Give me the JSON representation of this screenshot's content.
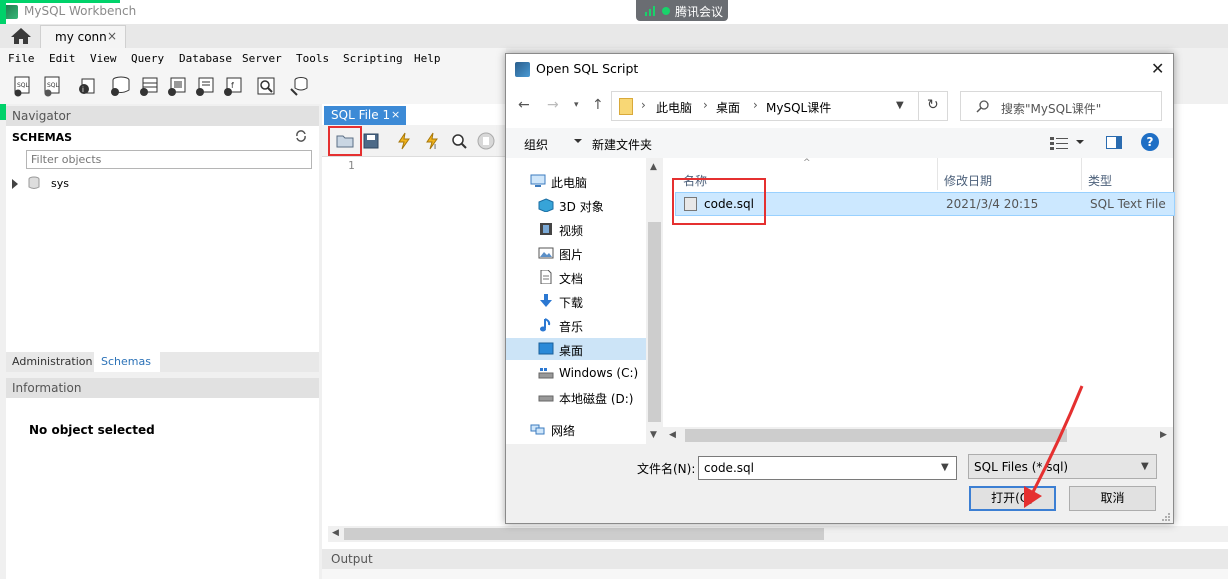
{
  "app": {
    "title": "MySQL Workbench"
  },
  "meeting": {
    "label": "腾讯会议"
  },
  "connection_tab": {
    "label": "my conn",
    "close": "×"
  },
  "menu": [
    "File",
    "Edit",
    "View",
    "Query",
    "Database",
    "Server",
    "Tools",
    "Scripting",
    "Help"
  ],
  "navigator": {
    "header": "Navigator",
    "schemas_title": "SCHEMAS",
    "filter_placeholder": "Filter objects",
    "schemas": [
      "sys"
    ]
  },
  "bottom_tabs": {
    "administration": "Administration",
    "schemas": "Schemas"
  },
  "information": {
    "header": "Information",
    "message": "No object selected"
  },
  "editor": {
    "tab_label": "SQL File 1",
    "tab_close": "×",
    "line_number": "1"
  },
  "output": {
    "header": "Output"
  },
  "dialog": {
    "title": "Open SQL Script",
    "close": "✕",
    "breadcrumb": [
      "此电脑",
      "桌面",
      "MySQL课件"
    ],
    "search_placeholder": "搜索\"MySQL课件\"",
    "organize": "组织",
    "new_folder": "新建文件夹",
    "tree": [
      {
        "label": "此电脑",
        "icon": "computer-icon"
      },
      {
        "label": "3D 对象",
        "icon": "3d-objects-icon"
      },
      {
        "label": "视频",
        "icon": "video-icon"
      },
      {
        "label": "图片",
        "icon": "pictures-icon"
      },
      {
        "label": "文档",
        "icon": "documents-icon"
      },
      {
        "label": "下载",
        "icon": "download-icon"
      },
      {
        "label": "音乐",
        "icon": "music-icon"
      },
      {
        "label": "桌面",
        "icon": "desktop-icon",
        "selected": true
      },
      {
        "label": "Windows (C:)",
        "icon": "drive-c-icon"
      },
      {
        "label": "本地磁盘 (D:)",
        "icon": "drive-d-icon"
      },
      {
        "label": "网络",
        "icon": "network-icon"
      }
    ],
    "columns": {
      "name": "名称",
      "date": "修改日期",
      "type": "类型"
    },
    "files": [
      {
        "name": "code.sql",
        "modified": "2021/3/4 20:15",
        "type": "SQL Text File"
      }
    ],
    "filename_label": "文件名(N):",
    "filename_value": "code.sql",
    "filetype_value": "SQL Files (*.sql)",
    "open_button": "打开(O)",
    "cancel_button": "取消"
  },
  "colors": {
    "accent_blue": "#3c8ad6",
    "highlight_red": "#e53030",
    "selection": "#cce8ff",
    "meeting_green": "#19d36b"
  }
}
